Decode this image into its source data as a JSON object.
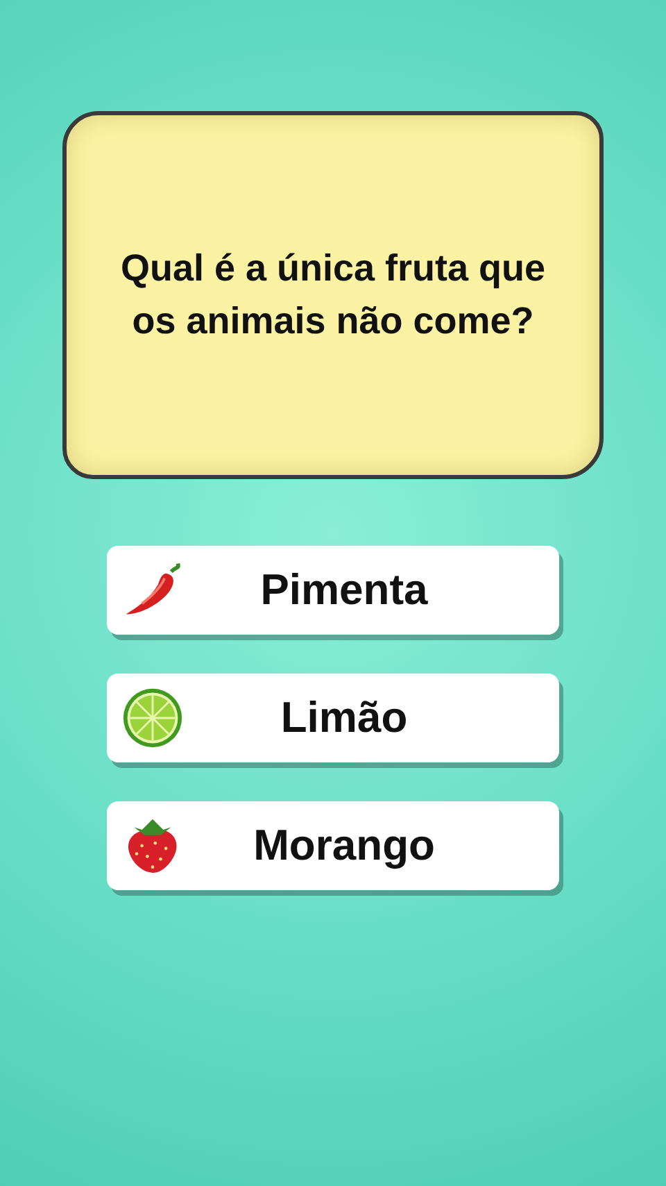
{
  "question": "Qual é a única fruta que os animais não come?",
  "answers": [
    {
      "label": "Pimenta",
      "kind": "chili"
    },
    {
      "label": "Limão",
      "kind": "lime"
    },
    {
      "label": "Morango",
      "kind": "strawberry"
    }
  ]
}
